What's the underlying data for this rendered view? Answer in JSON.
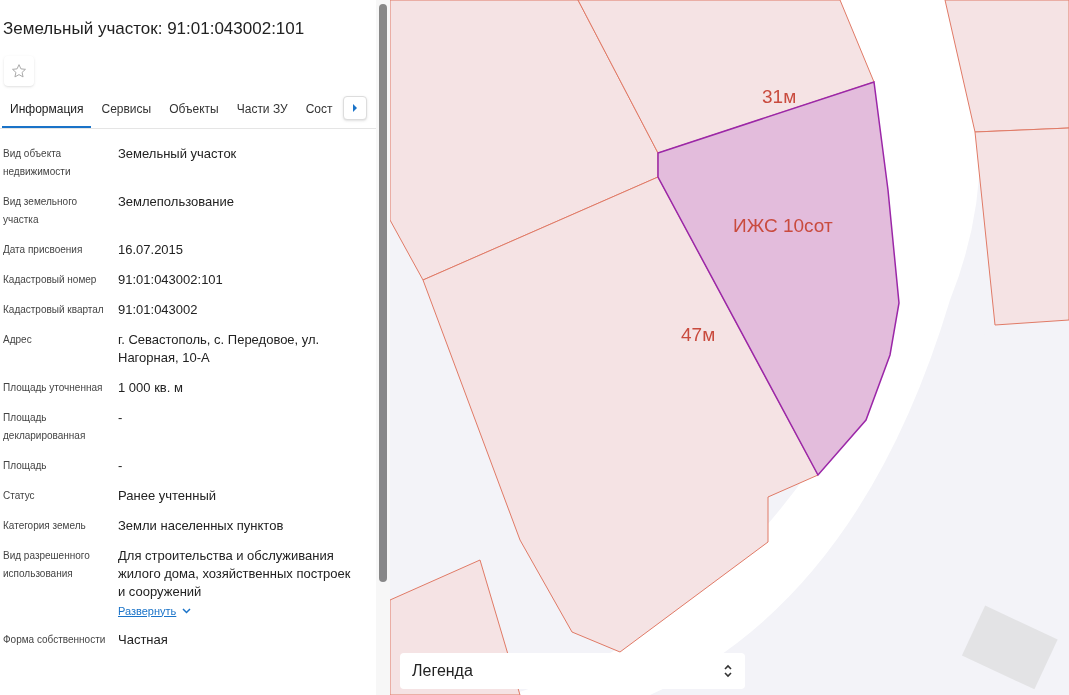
{
  "panel": {
    "title": "Земельный участок: 91:01:043002:101",
    "tabs": [
      {
        "label": "Информация",
        "selected": true
      },
      {
        "label": "Сервисы",
        "selected": false
      },
      {
        "label": "Объекты",
        "selected": false
      },
      {
        "label": "Части ЗУ",
        "selected": false
      },
      {
        "label": "Сост",
        "selected": false
      }
    ],
    "fields": [
      {
        "label": "Вид объекта недвижимости",
        "value": "Земельный участок"
      },
      {
        "label": "Вид земельного участка",
        "value": "Землепользование"
      },
      {
        "label": "Дата присвоения",
        "value": "16.07.2015"
      },
      {
        "label": "Кадастровый номер",
        "value": "91:01:043002:101"
      },
      {
        "label": "Кадастровый квартал",
        "value": "91:01:043002"
      },
      {
        "label": "Адрес",
        "value": "г. Севастополь, с. Передовое, ул. Нагорная, 10-А"
      },
      {
        "label": "Площадь уточненная",
        "value": "1 000 кв. м"
      },
      {
        "label": "Площадь декларированная",
        "value": "-"
      },
      {
        "label": "Площадь",
        "value": "-"
      },
      {
        "label": "Статус",
        "value": "Ранее учтенный"
      },
      {
        "label": "Категория земель",
        "value": "Земли населенных пунктов"
      },
      {
        "label": "Вид разрешенного использования",
        "value": "Для строительства и обслуживания жилого дома, хозяйственных построек и сооружений",
        "link": "Развернуть"
      },
      {
        "label": "Форма собственности",
        "value": "Частная"
      }
    ]
  },
  "map": {
    "labels": [
      {
        "text": "31м"
      },
      {
        "text": "ИЖС 10сот"
      },
      {
        "text": "47м"
      }
    ],
    "legend": {
      "label": "Легенда"
    }
  }
}
